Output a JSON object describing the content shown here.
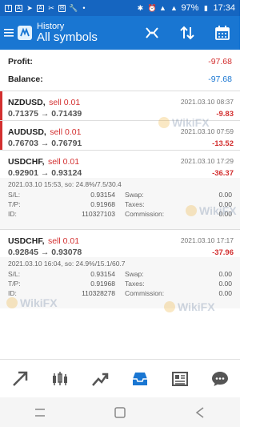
{
  "status_bar": {
    "battery": "97%",
    "time": "17:34"
  },
  "app_bar": {
    "title": "History",
    "subtitle": "All symbols"
  },
  "summary": {
    "profit_label": "Profit:",
    "profit_value": "-97.68",
    "balance_label": "Balance:",
    "balance_value": "-97.68"
  },
  "positions": [
    {
      "symbol": "NZDUSD,",
      "direction": "sell 0.01",
      "time": "2021.03.10 08:37",
      "prices": "0.71375 → 0.71439",
      "profit": "-9.83"
    },
    {
      "symbol": "AUDUSD,",
      "direction": "sell 0.01",
      "time": "2021.03.10 07:59",
      "prices": "0.76703 → 0.76791",
      "profit": "-13.52"
    },
    {
      "symbol": "USDCHF,",
      "direction": "sell 0.01",
      "time": "2021.03.10 17:29",
      "prices": "0.92901 → 0.93124",
      "profit": "-36.37",
      "info": "2021.03.10 15:53, so: 24.8%/7.5/30.4",
      "sl": "0.93154",
      "tp": "0.91968",
      "id": "110327103",
      "swap": "0.00",
      "taxes": "0.00",
      "commission": "0.00"
    },
    {
      "symbol": "USDCHF,",
      "direction": "sell 0.01",
      "time": "2021.03.10 17:17",
      "prices": "0.92845 → 0.93078",
      "profit": "-37.96",
      "info": "2021.03.10 16:04, so: 24.9%/15.1/60.7",
      "sl": "0.93154",
      "tp": "0.91968",
      "id": "110328278",
      "swap": "0.00",
      "taxes": "0.00",
      "commission": "0.00"
    }
  ],
  "detail_labels": {
    "sl": "S/L:",
    "tp": "T/P:",
    "id": "ID:",
    "swap": "Swap:",
    "taxes": "Taxes:",
    "commission": "Commission:"
  },
  "watermark_text": "WikiFX",
  "colors": {
    "status_bar": "#1565c0",
    "app_bar": "#1976d2",
    "loss": "#d32f2f",
    "balance": "#1976d2",
    "active_nav": "#1976d2"
  },
  "icons": {
    "app_bar_actions": [
      "split-arrows-icon",
      "sort-arrows-icon",
      "calendar-icon"
    ],
    "bottom_nav": [
      "quotes-icon",
      "chart-icon",
      "trade-icon",
      "history-icon",
      "news-icon",
      "chat-icon"
    ],
    "system_nav": [
      "recent-apps-icon",
      "home-icon",
      "back-icon"
    ]
  }
}
